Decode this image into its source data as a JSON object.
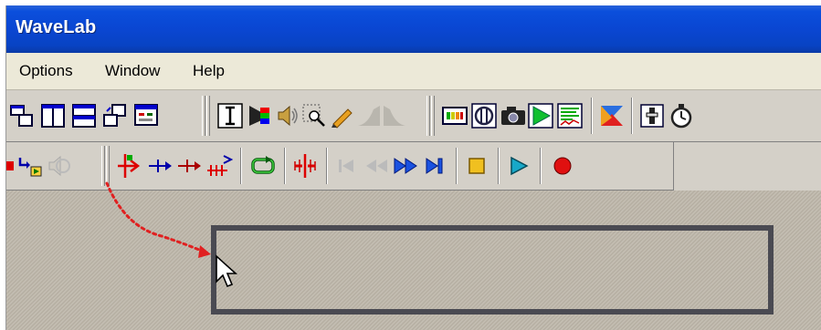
{
  "window": {
    "title": "WaveLab"
  },
  "menu": {
    "items": [
      "Options",
      "Window",
      "Help"
    ]
  },
  "colors": {
    "titlebar": "#0b4fdc",
    "menubar": "#ece9d8",
    "toolbar": "#d4d0c8",
    "frame_rect": "#4a4a52",
    "annotation_arrow": "#e02020",
    "workspace": "#bcb5a8"
  },
  "toolbar_top": {
    "icons": [
      "window-tile-icon",
      "columns-icon",
      "rows-icon",
      "window-switch-icon",
      "panel-icon",
      "text-cursor-icon",
      "color-palette-icon",
      "speaker-icon",
      "zoom-icon",
      "pencil-icon",
      "fade-in-icon",
      "fade-out-icon",
      "meter-icon",
      "plugin-icon",
      "camera-icon",
      "play-range-icon",
      "spectrum-icon",
      "crossfade-icon",
      "fader-icon",
      "stopwatch-icon"
    ]
  },
  "toolbar_transport": {
    "icons": [
      "marker-icon",
      "marker-set-icon",
      "speaker-disabled-icon",
      "insert-marker-icon",
      "next-marker-icon",
      "prev-marker-icon",
      "multi-marker-icon",
      "loop-icon",
      "split-icon",
      "go-start-icon",
      "rewind-icon",
      "fast-forward-icon",
      "go-end-icon",
      "stop-icon",
      "play-icon",
      "record-icon"
    ]
  }
}
